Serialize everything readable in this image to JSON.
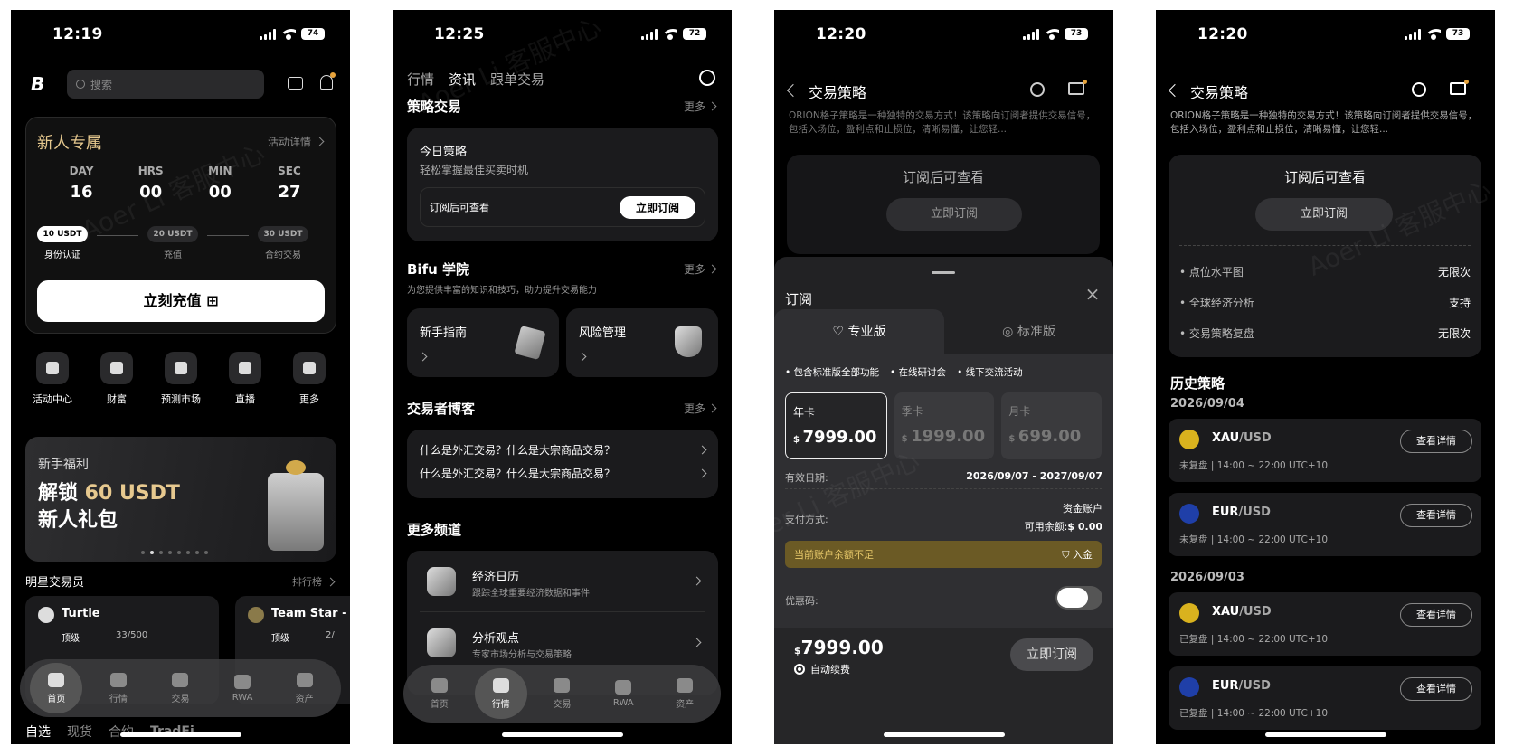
{
  "screens": {
    "s1": {
      "time": "12:19",
      "battery": "74",
      "search_placeholder": "搜索",
      "promo": {
        "title": "新人专属",
        "link": "活动详情",
        "units": [
          {
            "u": "DAY",
            "v": "16"
          },
          {
            "u": "HRS",
            "v": "00"
          },
          {
            "u": "MIN",
            "v": "00"
          },
          {
            "u": "SEC",
            "v": "27"
          }
        ],
        "steps": [
          {
            "amt": "10 USDT",
            "lbl": "身份认证"
          },
          {
            "amt": "20 USDT",
            "lbl": "充值"
          },
          {
            "amt": "30 USDT",
            "lbl": "合约交易"
          }
        ],
        "cta": "立刻充值"
      },
      "shortcuts": [
        "活动中心",
        "财富",
        "预测市场",
        "直播",
        "更多"
      ],
      "banner": {
        "kicker": "新手福利",
        "line1a": "解锁 ",
        "line1b": "60 USDT",
        "line2": "新人礼包"
      },
      "traders": {
        "title": "明星交易员",
        "link": "排行榜",
        "cards": [
          {
            "name": "Turtle",
            "level": "顶级",
            "count": "33/500"
          },
          {
            "name": "Team Star -",
            "level": "顶级",
            "count": "2/"
          }
        ]
      },
      "tabs": [
        "首页",
        "行情",
        "交易",
        "RWA",
        "资产"
      ],
      "bottom_tabs": [
        "自选",
        "现货",
        "合约",
        "TradFi"
      ]
    },
    "s2": {
      "time": "12:25",
      "battery": "72",
      "top_tabs": [
        "行情",
        "资讯",
        "跟单交易"
      ],
      "strategy": {
        "title": "策略交易",
        "more": "更多",
        "card_title": "今日策略",
        "card_sub": "轻松掌握最佳买卖时机",
        "row_label": "订阅后可查看",
        "btn": "立即订阅"
      },
      "academy": {
        "title": "Bifu 学院",
        "more": "更多",
        "sub": "为您提供丰富的知识和技巧，助力提升交易能力",
        "items": [
          "新手指南",
          "风险管理"
        ]
      },
      "blog": {
        "title": "交易者博客",
        "more": "更多",
        "items": [
          "什么是外汇交易？什么是大宗商品交易？",
          "什么是外汇交易？什么是大宗商品交易？"
        ]
      },
      "channels": {
        "title": "更多频道",
        "items": [
          {
            "t": "经济日历",
            "s": "跟踪全球重要经济数据和事件"
          },
          {
            "t": "分析观点",
            "s": "专家市场分析与交易策略"
          }
        ]
      },
      "tabs": [
        "首页",
        "行情",
        "交易",
        "RWA",
        "资产"
      ]
    },
    "s3": {
      "time": "12:20",
      "battery": "73",
      "header": "交易策略",
      "desc": "ORION格子策略是一种独特的交易方式！该策略向订阅者提供交易信号，包括入场位，盈利点和止损位，清晰易懂，让您轻...",
      "locked": "订阅后可查看",
      "locked_btn": "立即订阅",
      "sheet": {
        "title": "订阅",
        "tab_pro": "专业版",
        "tab_std": "标准版",
        "features": [
          "包含标准版全部功能",
          "在线研讨会",
          "线下交流活动"
        ],
        "plans": [
          {
            "n": "年卡",
            "p": "7999.00"
          },
          {
            "n": "季卡",
            "p": "1999.00"
          },
          {
            "n": "月卡",
            "p": "699.00"
          }
        ],
        "currency": "$",
        "valid_label": "有效日期:",
        "valid": "2026/09/07 - 2027/09/07",
        "pay_label": "支付方式:",
        "pay_account": "资金账户",
        "balance_label": "可用余额:",
        "balance": "$ 0.00",
        "warn": "当前账户余额不足",
        "deposit": "入金",
        "coupon": "优惠码:",
        "total": "7999.00",
        "auto": "自动续费",
        "submit": "立即订阅"
      }
    },
    "s4": {
      "time": "12:20",
      "battery": "73",
      "header": "交易策略",
      "desc": "ORION格子策略是一种独特的交易方式！该策略向订阅者提供交易信号，包括入场位，盈利点和止损位，清晰易懂，让您轻...",
      "locked": "订阅后可查看",
      "locked_btn": "立即订阅",
      "features": [
        {
          "k": "点位水平图",
          "v": "无限次"
        },
        {
          "k": "全球经济分析",
          "v": "支持"
        },
        {
          "k": "交易策略复盘",
          "v": "无限次"
        }
      ],
      "history_title": "历史策略",
      "groups": [
        {
          "date": "2026/09/04",
          "items": [
            {
              "base": "XAU",
              "quote": "/USD",
              "status": "未复盘 | 14:00 ~ 22:00 UTC+10",
              "btn": "查看详情",
              "coin": "#d9b21e"
            },
            {
              "base": "EUR",
              "quote": "/USD",
              "status": "未复盘 | 14:00 ~ 22:00 UTC+10",
              "btn": "查看详情",
              "coin": "#1f3fa8"
            }
          ]
        },
        {
          "date": "2026/09/03",
          "items": [
            {
              "base": "XAU",
              "quote": "/USD",
              "status": "已复盘 | 14:00 ~ 22:00 UTC+10",
              "btn": "查看详情",
              "coin": "#d9b21e"
            },
            {
              "base": "EUR",
              "quote": "/USD",
              "status": "已复盘 | 14:00 ~ 22:00 UTC+10",
              "btn": "查看详情",
              "coin": "#1f3fa8"
            }
          ]
        }
      ]
    }
  },
  "watermark": "Aoer Li 客服中心",
  "colors": {
    "accent_gold": "#e7c98f",
    "warn_bg": "#6b5a25",
    "warn_text": "#e8c96a"
  }
}
